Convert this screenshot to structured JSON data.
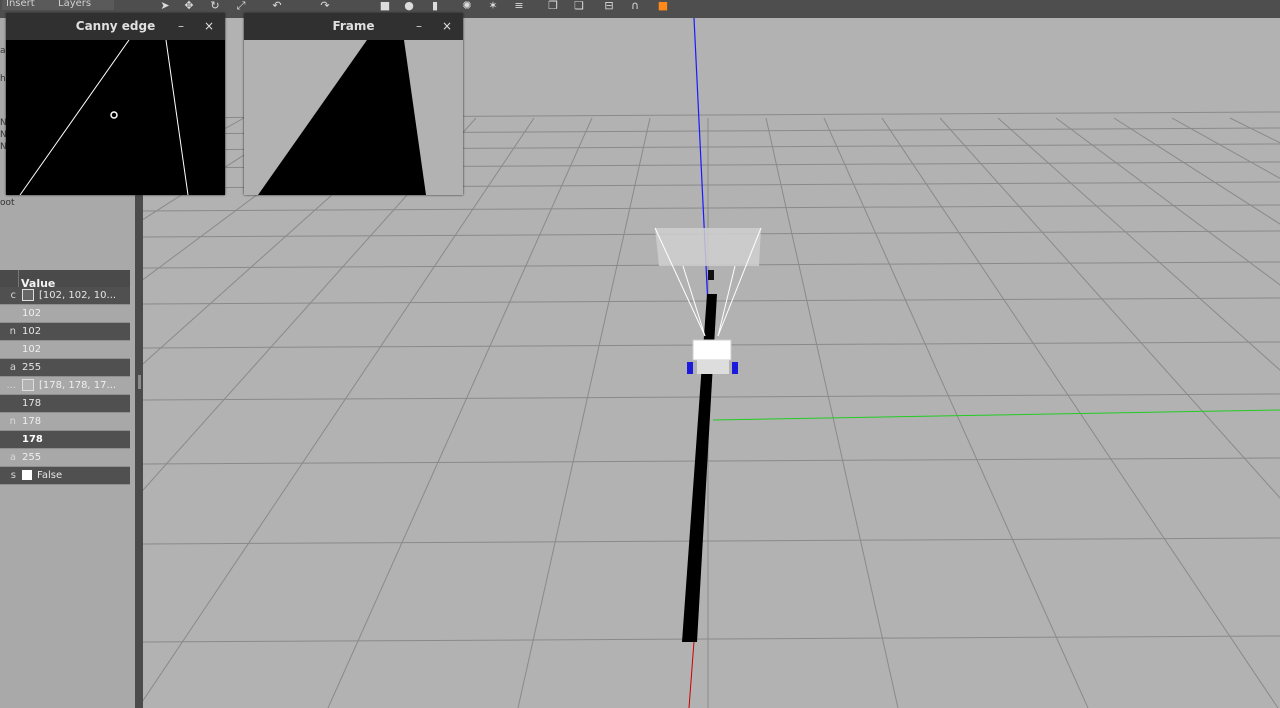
{
  "toolbar": {
    "tabs": [
      {
        "label": "Insert"
      },
      {
        "label": "Layers"
      }
    ],
    "icons": [
      "select-icon",
      "translate-icon",
      "rotate-icon",
      "scale-icon",
      "undo-icon",
      "redo-icon",
      "box-icon",
      "sphere-icon",
      "cylinder-icon",
      "point-light-icon",
      "spot-light-icon",
      "directional-light-icon",
      "copy-icon",
      "paste-icon",
      "align-icon",
      "snap-icon",
      "orange-square-icon"
    ]
  },
  "left_panel": {
    "fragments": [
      "a",
      "h",
      "N",
      "N",
      "N",
      "oot"
    ],
    "table": {
      "header": "Value",
      "rows": [
        {
          "key": "c",
          "value": "[102, 102, 10...",
          "swatch": "#666666",
          "style": "dark"
        },
        {
          "key": "",
          "value": "102",
          "style": "light"
        },
        {
          "key": "n",
          "value": "102",
          "style": "dark"
        },
        {
          "key": "",
          "value": "102",
          "style": "light"
        },
        {
          "key": "a",
          "value": "255",
          "style": "dark"
        },
        {
          "key": "...",
          "value": "[178, 178, 17...",
          "swatch": "#b2b2b2",
          "style": "light"
        },
        {
          "key": "",
          "value": "178",
          "style": "dark"
        },
        {
          "key": "n",
          "value": "178",
          "style": "light"
        },
        {
          "key": "",
          "value": "178",
          "style": "dark",
          "bold": true
        },
        {
          "key": "a",
          "value": "255",
          "style": "light"
        },
        {
          "key": "s",
          "value": "False",
          "checkbox": true,
          "style": "dark"
        }
      ]
    }
  },
  "windows": {
    "canny": {
      "title": "Canny edge",
      "minimize": "–",
      "close": "×"
    },
    "frame": {
      "title": "Frame",
      "minimize": "–",
      "close": "×"
    }
  },
  "colors": {
    "ground": "#b2b2b2",
    "grid": "#8a8a8a",
    "axis_x": "#cc0000",
    "axis_y": "#22cc22",
    "axis_z": "#1a1aff"
  }
}
